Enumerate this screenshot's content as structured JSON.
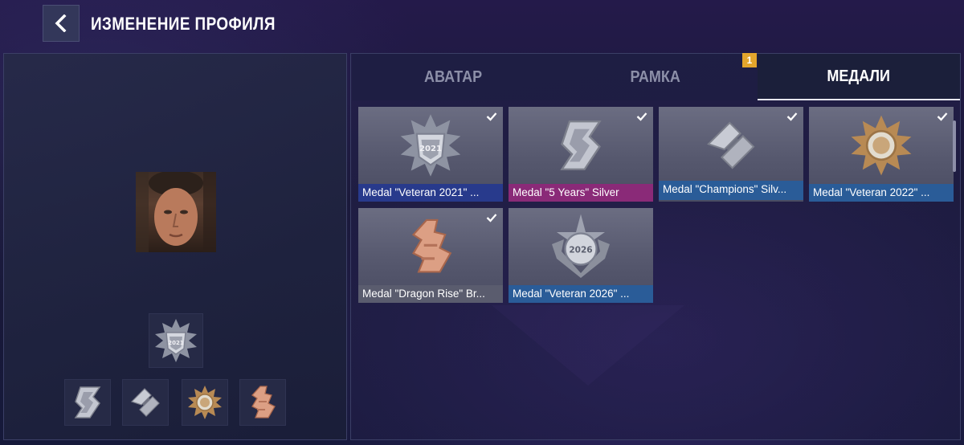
{
  "header": {
    "title": "ИЗМЕНЕНИЕ ПРОФИЛЯ",
    "back_icon": "chevron-left-icon"
  },
  "profile": {
    "main_medal": "medal-veteran-2021",
    "equipped_slots": [
      "medal-5-years",
      "medal-champions",
      "medal-veteran-2022",
      "medal-dragon-rise"
    ]
  },
  "tabs": {
    "items": [
      {
        "label": "АВАТАР",
        "active": false
      },
      {
        "label": "РАМКА",
        "active": false,
        "badge": "1"
      },
      {
        "label": "МЕДАЛИ",
        "active": true
      }
    ]
  },
  "medals": [
    {
      "label": "Medal \"Veteran 2021\" ...",
      "selected": true,
      "bar_color": "#283a8c"
    },
    {
      "label": "Medal \"5 Years\" Silver",
      "selected": true,
      "bar_color": "#8a2a78"
    },
    {
      "label": "Medal \"Champions\" Silv...",
      "selected": true,
      "bar_color": "#2a5c98"
    },
    {
      "label": "Medal \"Veteran 2022\" ...",
      "selected": true,
      "bar_color": "#2a5c98"
    },
    {
      "label": "Medal \"Dragon Rise\" Br...",
      "selected": true,
      "bar_color": "#5a5c6e"
    },
    {
      "label": "Medal \"Veteran 2026\" ...",
      "selected": false,
      "bar_color": "#2a5c98"
    }
  ],
  "colors": {
    "badge": "#e3a52c",
    "background": "#171736",
    "silver": "#c9ccd6",
    "bronze": "#d99a7a",
    "gold": "#c79a5a"
  }
}
